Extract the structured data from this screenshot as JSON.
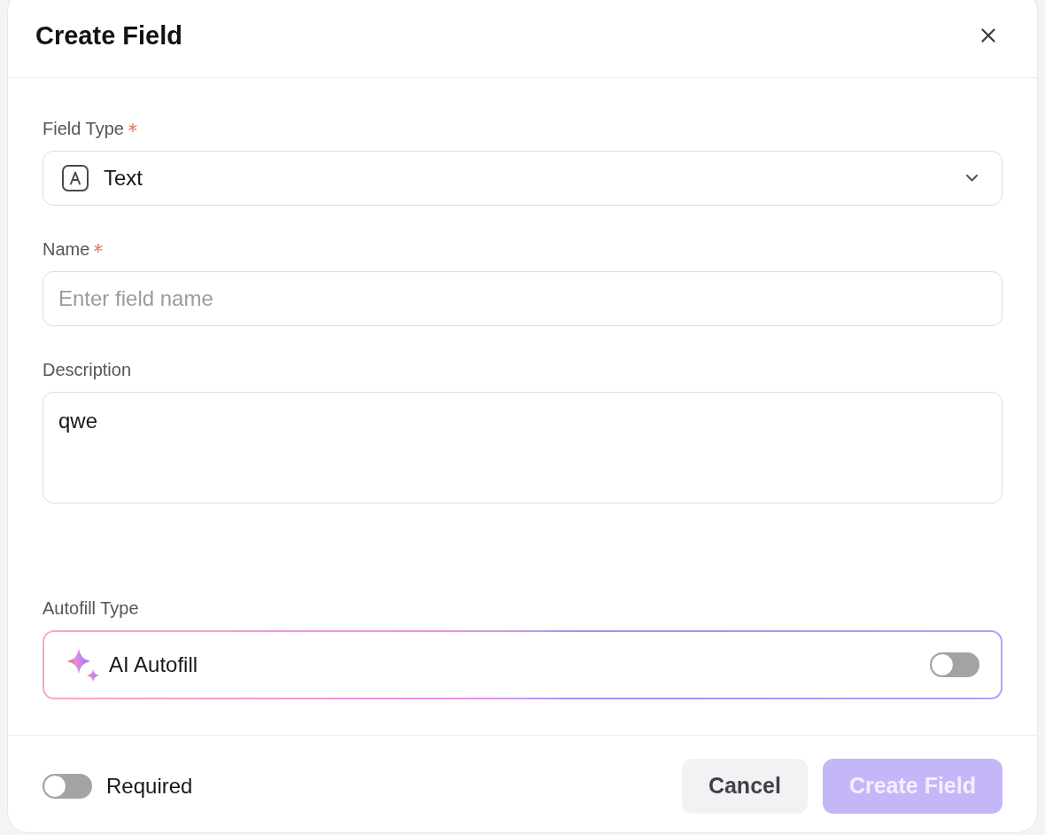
{
  "dialog": {
    "title": "Create Field"
  },
  "fields": [
    {
      "kind": "select",
      "label": "Field Type",
      "required": true,
      "value": "Text"
    },
    {
      "kind": "input",
      "label": "Name",
      "required": true,
      "placeholder": "Enter field name"
    },
    {
      "kind": "textarea",
      "label": "Description",
      "required": false,
      "value": "qwe"
    },
    {
      "kind": "toggle_card",
      "label": "Autofill Type",
      "required": false,
      "option": "AI Autofill",
      "on": false
    }
  ],
  "footer": {
    "required_toggle": {
      "label": "Required",
      "on": false
    },
    "buttons": [
      {
        "label": "Cancel",
        "kind": "secondary",
        "disabled": false
      },
      {
        "label": "Create Field",
        "kind": "primary",
        "disabled": true
      }
    ]
  }
}
